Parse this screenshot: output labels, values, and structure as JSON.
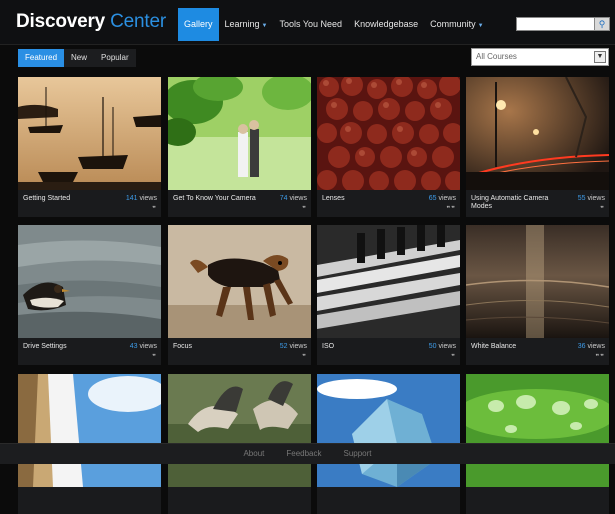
{
  "header": {
    "logo_primary": "Discovery",
    "logo_secondary": "Center",
    "nav": [
      {
        "label": "Gallery",
        "active": true,
        "dropdown": false
      },
      {
        "label": "Learning",
        "active": false,
        "dropdown": true
      },
      {
        "label": "Tools You Need",
        "active": false,
        "dropdown": false
      },
      {
        "label": "Knowledgebase",
        "active": false,
        "dropdown": false
      },
      {
        "label": "Community",
        "active": false,
        "dropdown": true
      }
    ],
    "search": {
      "value": "",
      "button_icon": "search-icon"
    }
  },
  "filters": {
    "tabs": [
      "Featured",
      "New",
      "Popular"
    ],
    "active_tab": "Featured",
    "course_select": "All Courses"
  },
  "gallery": [
    {
      "title": "Getting Started",
      "views": "141",
      "scene": "harbor-sunset"
    },
    {
      "title": "Get To Know Your Camera",
      "views": "74",
      "scene": "wedding-leaves"
    },
    {
      "title": "Lenses",
      "views": "65",
      "scene": "chestnuts"
    },
    {
      "title": "Using Automatic Camera Modes",
      "views": "55",
      "scene": "night-road"
    },
    {
      "title": "Drive Settings",
      "views": "43",
      "scene": "duck-water"
    },
    {
      "title": "Focus",
      "views": "52",
      "scene": "running-dog"
    },
    {
      "title": "ISO",
      "views": "50",
      "scene": "piano-keys"
    },
    {
      "title": "White Balance",
      "views": "36",
      "scene": "sunset-sea"
    },
    {
      "title": "",
      "views": "",
      "scene": "waterfall-sky"
    },
    {
      "title": "",
      "views": "",
      "scene": "geese"
    },
    {
      "title": "",
      "views": "",
      "scene": "ice-rock"
    },
    {
      "title": "",
      "views": "",
      "scene": "water-drops"
    }
  ],
  "views_label": "views",
  "footer": [
    "About",
    "Feedback",
    "Support"
  ],
  "colors": {
    "accent": "#2a8fe4",
    "header_bg": "#0f1012",
    "page_bg": "#0b0b0b"
  }
}
